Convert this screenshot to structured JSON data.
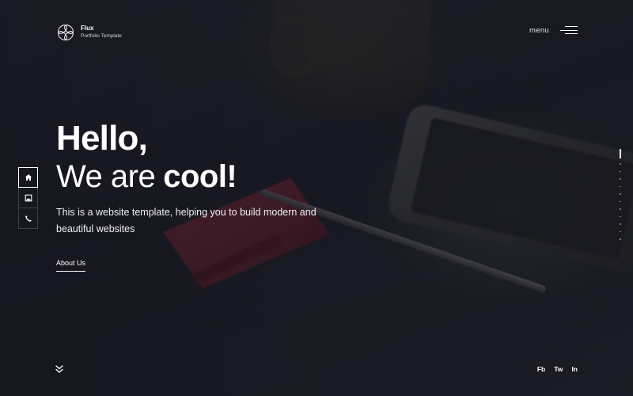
{
  "brand": {
    "name": "Flux",
    "tagline": "Portfolio Template",
    "logo_icon": "interlocking-loops-logo"
  },
  "header": {
    "menu_label": "menu",
    "menu_icon": "hamburger-menu-icon"
  },
  "hero": {
    "line1": "Hello,",
    "line2_light": "We are",
    "line2_bold": "cool!",
    "description": "This is a website template, helping you to build modern and beautiful websites",
    "cta_label": "About Us"
  },
  "side_nav": {
    "items": [
      {
        "icon": "home-icon",
        "active": true
      },
      {
        "icon": "image-icon",
        "active": false
      },
      {
        "icon": "phone-icon",
        "active": false
      }
    ]
  },
  "pager": {
    "total": 12,
    "active_index": 0
  },
  "footer": {
    "scroll_icon": "double-chevron-down-icon",
    "social": [
      "Fb",
      "Tw",
      "In"
    ]
  },
  "colors": {
    "background": "#1a1b24",
    "text": "#ffffff",
    "accent_notepad": "#5c2230"
  }
}
